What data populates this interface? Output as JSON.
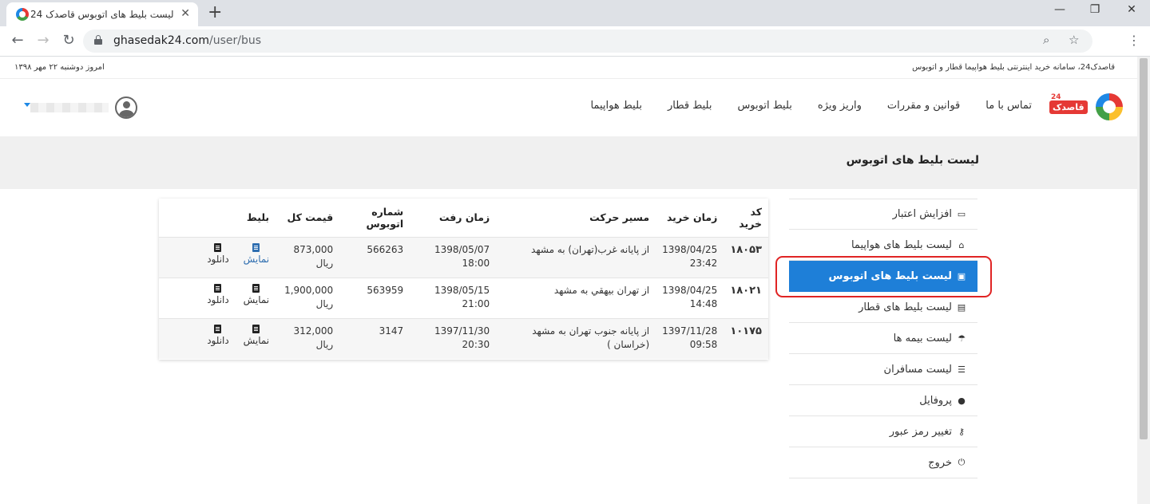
{
  "browser": {
    "tab_title": "لیست بلیط های اتوبوس قاصدک 24",
    "url_host": "ghasedak24.com",
    "url_path": "/user/bus"
  },
  "topbar": {
    "slogan": "قاصدک24، سامانه خرید اینترنتی بلیط هواپیما قطار و اتوبوس",
    "today": "امروز دوشنبه ۲۲ مهر ۱۳۹۸"
  },
  "nav": {
    "logo_text": "قاصدک",
    "logo_badge": "24",
    "links": [
      "بلیط هواپیما",
      "بلیط قطار",
      "بلیط اتوبوس",
      "واریز ویژه",
      "قوانین و مقررات",
      "تماس با ما"
    ]
  },
  "page": {
    "title": "لیست بلیط های اتوبوس"
  },
  "sidebar": {
    "items": [
      {
        "label": "افزایش اعتبار",
        "icon": "battery-icon"
      },
      {
        "label": "لیست بلیط های هواپیما",
        "icon": "home-icon"
      },
      {
        "label": "لیست بلیط های اتوبوس",
        "icon": "bus-icon",
        "active": true
      },
      {
        "label": "لیست بلیط های قطار",
        "icon": "train-icon"
      },
      {
        "label": "لیست بیمه ها",
        "icon": "umbrella-icon"
      },
      {
        "label": "لیست مسافران",
        "icon": "list-icon"
      },
      {
        "label": "پروفایل",
        "icon": "user-icon"
      },
      {
        "label": "تغییر رمز عبور",
        "icon": "key-icon"
      },
      {
        "label": "خروج",
        "icon": "power-icon"
      }
    ]
  },
  "table": {
    "headers": {
      "code": "کد خرید",
      "purchase_time": "زمان خرید",
      "route": "مسیر حرکت",
      "departure_time": "زمان رفت",
      "bus_number": "شماره اتوبوس",
      "total_price": "قیمت کل",
      "ticket": "بلیط"
    },
    "rows": [
      {
        "code": "۱۸۰۵۳",
        "purchase_date": "1398/04/25",
        "purchase_clock": "23:42",
        "route": "از پایانه غرب(تهران) به مشهد",
        "depart_date": "1398/05/07",
        "depart_clock": "18:00",
        "bus_number": "566263",
        "price": "873,000",
        "currency": "ریال",
        "view": "نمایش",
        "download": "دانلود"
      },
      {
        "code": "۱۸۰۲۱",
        "purchase_date": "1398/04/25",
        "purchase_clock": "14:48",
        "route": "از تهران بیهقي به مشهد",
        "depart_date": "1398/05/15",
        "depart_clock": "21:00",
        "bus_number": "563959",
        "price": "1,900,000",
        "currency": "ریال",
        "view": "نمایش",
        "download": "دانلود"
      },
      {
        "code": "۱۰۱۷۵",
        "purchase_date": "1397/11/28",
        "purchase_clock": "09:58",
        "route": "از پایانه جنوب تهران به مشهد (خراسان )",
        "depart_date": "1397/11/30",
        "depart_clock": "20:30",
        "bus_number": "3147",
        "price": "312,000",
        "currency": "ریال",
        "view": "نمایش",
        "download": "دانلود"
      }
    ]
  },
  "colors": {
    "accent": "#1e7fd8",
    "highlight": "#e02424",
    "link": "#2f6eb0"
  }
}
